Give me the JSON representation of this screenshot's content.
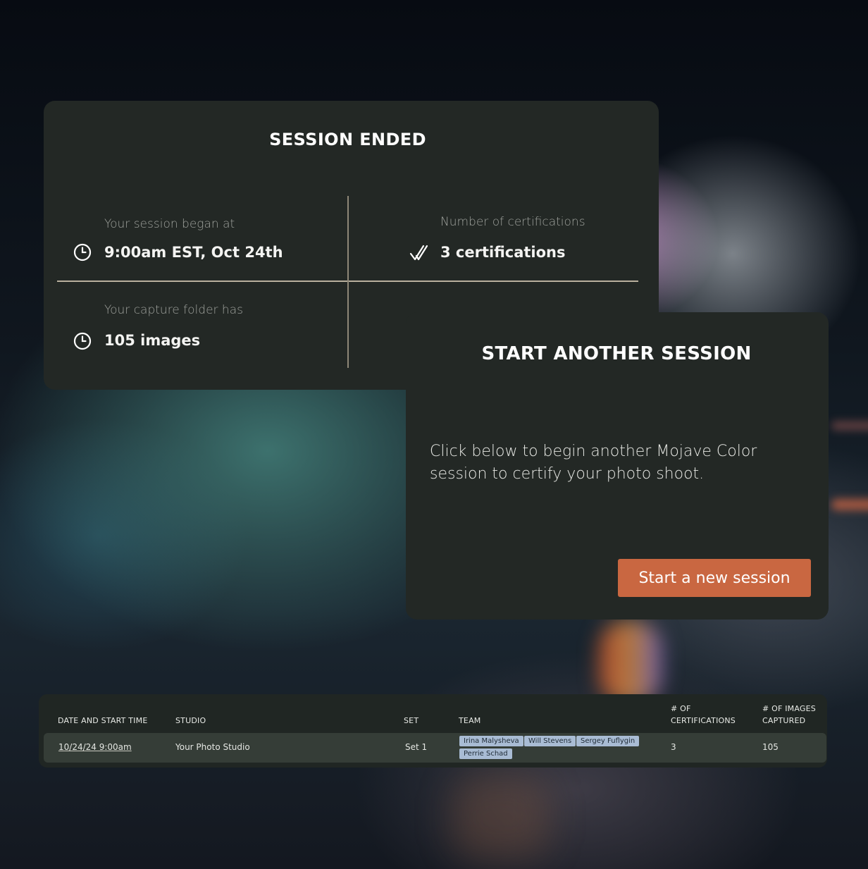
{
  "session_summary": {
    "title": "SESSION ENDED",
    "began_label": "Your session began at",
    "began_value": "9:00am EST, Oct 24th",
    "certifications_label": "Number of certifications",
    "certifications_value": "3 certifications",
    "folder_label": "Your capture folder has",
    "folder_value": "105 images"
  },
  "start_another": {
    "title": "START ANOTHER SESSION",
    "text_line1": "Click below to begin another Mojave Color",
    "text_line2": "session to certify your photo shoot.",
    "button_label": "Start a new session"
  },
  "sessions_table": {
    "headers": {
      "date": "DATE AND START TIME",
      "studio": "STUDIO",
      "set": "SET",
      "team": "TEAM",
      "certifications_line1": "# OF",
      "certifications_line2": "CERTIFICATIONS",
      "images_line1": "# OF IMAGES",
      "images_line2": "CAPTURED"
    },
    "rows": [
      {
        "date": "10/24/24 9:00am",
        "studio": "Your Photo Studio",
        "set": "Set 1",
        "team": [
          "Irina Malysheva",
          "Will Stevens",
          "Sergey Fuflygin",
          "Perrie Schad"
        ],
        "certifications": "3",
        "images": "105"
      }
    ]
  },
  "colors": {
    "card_bg": "#232825",
    "accent_button": "#c96741",
    "tag_bg": "#a9bcd4",
    "divider": "#b9b09e"
  },
  "icons": [
    "clock-icon",
    "double-check-icon",
    "clock-icon"
  ]
}
